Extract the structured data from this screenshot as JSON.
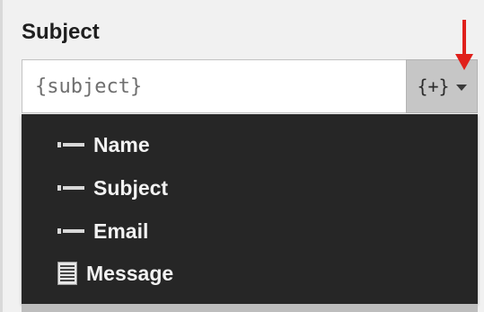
{
  "field": {
    "label": "Subject",
    "value": "{subject}"
  },
  "insert_button": {
    "label": "{+}",
    "caret_icon": "chevron-down-icon"
  },
  "annotation": {
    "arrow_color": "#e0201b"
  },
  "dropdown_menu": {
    "items": [
      {
        "label": "Name",
        "icon": "single-line-field-icon"
      },
      {
        "label": "Subject",
        "icon": "single-line-field-icon"
      },
      {
        "label": "Email",
        "icon": "single-line-field-icon"
      },
      {
        "label": "Message",
        "icon": "paragraph-field-icon"
      }
    ]
  },
  "colors": {
    "menu_background": "#262626",
    "menu_text": "#f2f2f2",
    "button_background": "#c6c6c6",
    "panel_background": "#f1f1f1"
  }
}
